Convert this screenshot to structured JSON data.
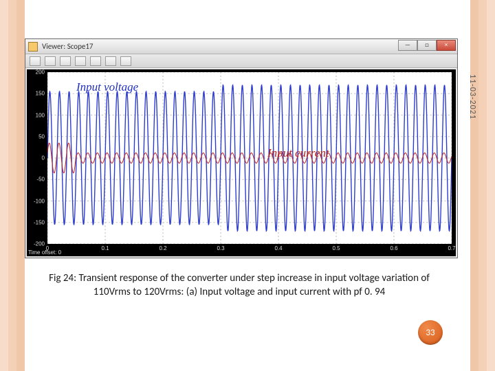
{
  "date_label": "11-03-2021",
  "window": {
    "title": "Viewer: Scope17",
    "buttons": {
      "min": "—",
      "max": "□",
      "close": "×"
    }
  },
  "labels": {
    "voltage": "Input voltage",
    "current": "Input current"
  },
  "caption": "Fig 24: Transient response of the converter under step increase in input voltage variation of 110Vrms to 120Vrms: (a) Input voltage and input current with pf 0. 94",
  "page_number": "33",
  "time_offset": "Time offset: 0",
  "chart_data": {
    "type": "line",
    "xlabel": "",
    "ylabel": "",
    "xlim": [
      0,
      0.7
    ],
    "ylim": [
      -200,
      200
    ],
    "xticks": [
      0,
      0.1,
      0.2,
      0.3,
      0.4,
      0.5,
      0.6,
      0.7
    ],
    "yticks": [
      -200,
      -150,
      -100,
      -50,
      0,
      50,
      100,
      150,
      200
    ],
    "annotations": [
      {
        "text": "Input voltage",
        "x": 0.07,
        "y": 165,
        "color": "blue"
      },
      {
        "text": "Input current",
        "x": 0.4,
        "y": 30,
        "color": "red"
      }
    ],
    "series": [
      {
        "name": "Input voltage",
        "color": "#2838d0",
        "kind": "sine",
        "frequency_hz": 60,
        "phase_deg": 0,
        "segments": [
          {
            "t0": 0.0,
            "t1": 0.3,
            "amplitude": 155
          },
          {
            "t0": 0.3,
            "t1": 0.7,
            "amplitude": 170
          }
        ],
        "note": "110 Vrms → 155 Vpk before t=0.3; 120 Vrms → 170 Vpk after"
      },
      {
        "name": "Input current",
        "color": "#c02828",
        "kind": "sine",
        "frequency_hz": 60,
        "phase_deg": 20,
        "segments": [
          {
            "t0": 0.0,
            "t1": 0.05,
            "amplitude": 35
          },
          {
            "t0": 0.05,
            "t1": 0.7,
            "amplitude": 12
          }
        ],
        "note": "Inrush spike then settles ~12 pk; pf ≈ 0.94 implies ~20° lag"
      }
    ]
  }
}
